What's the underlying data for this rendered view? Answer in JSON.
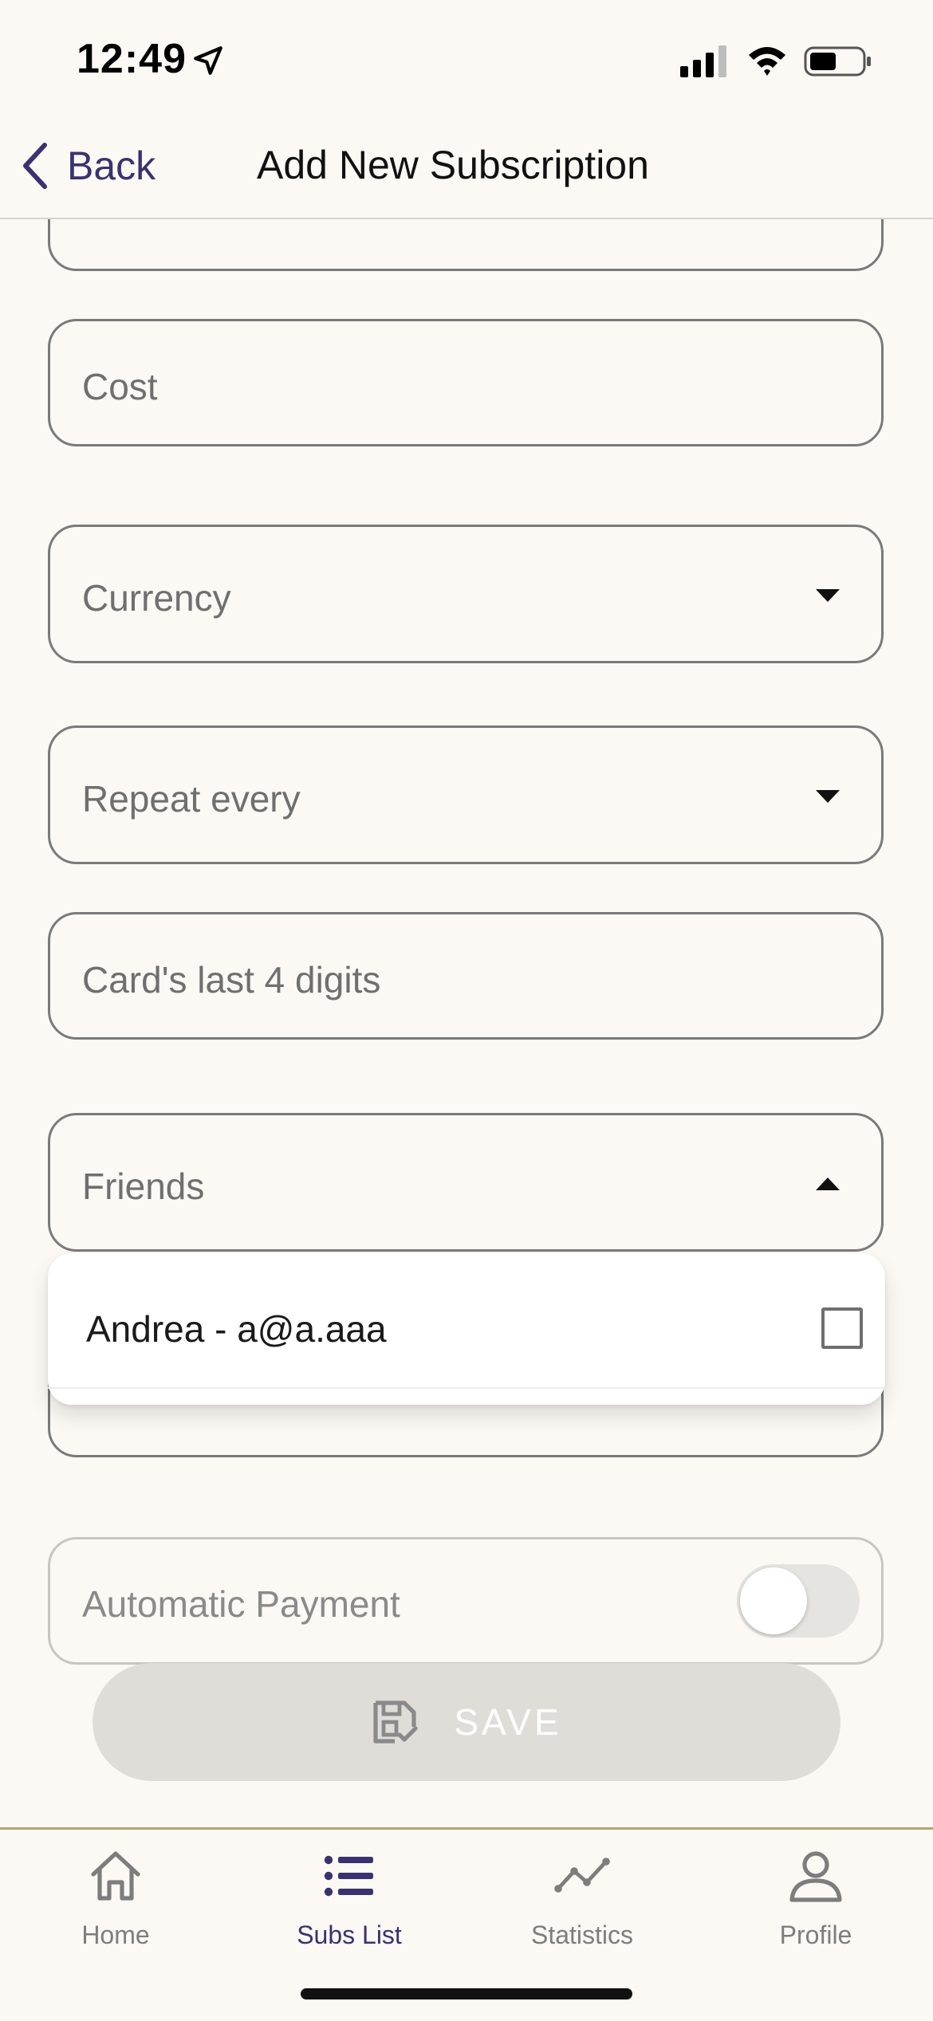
{
  "status_bar": {
    "time": "12:49"
  },
  "header": {
    "back_label": "Back",
    "title": "Add New Subscription"
  },
  "form": {
    "cost_placeholder": "Cost",
    "currency_placeholder": "Currency",
    "repeat_placeholder": "Repeat every",
    "card_placeholder": "Card's last 4 digits",
    "friends_placeholder": "Friends",
    "automatic_payment_label": "Automatic Payment",
    "automatic_payment_on": false
  },
  "friends_dropdown": {
    "open": true,
    "options": [
      {
        "label": "Andrea - a@a.aaa",
        "checked": false
      }
    ]
  },
  "save_button": {
    "label": "SAVE",
    "enabled": false
  },
  "tabs": [
    {
      "label": "Home",
      "icon": "home-icon",
      "active": false
    },
    {
      "label": "Subs List",
      "icon": "list-icon",
      "active": true
    },
    {
      "label": "Statistics",
      "icon": "chart-line-icon",
      "active": false
    },
    {
      "label": "Profile",
      "icon": "person-icon",
      "active": false
    }
  ],
  "colors": {
    "background": "#fcf8f4",
    "accent": "#3a3270",
    "tab_bar_border": "#b1a66d",
    "disabled_button": "#e0ddd9"
  }
}
